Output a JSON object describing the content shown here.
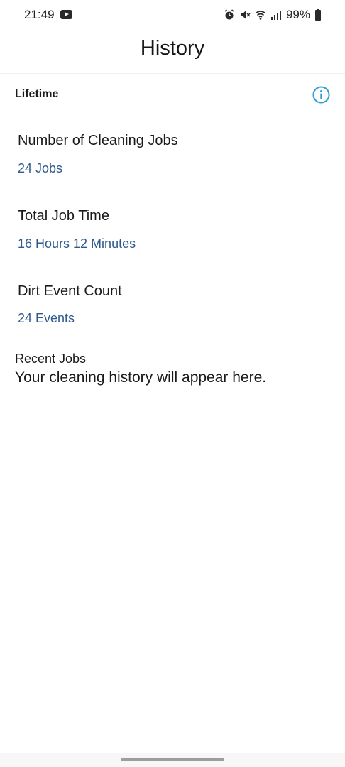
{
  "status_bar": {
    "time": "21:49",
    "battery": "99%",
    "icons": [
      "youtube-icon",
      "alarm-icon",
      "mute-icon",
      "wifi-icon",
      "signal-icon",
      "battery-icon"
    ]
  },
  "header": {
    "title": "History"
  },
  "lifetime": {
    "label": "Lifetime",
    "info_icon": "info-icon",
    "stats": [
      {
        "title": "Number of Cleaning Jobs",
        "value": "24 Jobs"
      },
      {
        "title": "Total Job Time",
        "value": "16 Hours 12 Minutes"
      },
      {
        "title": "Dirt Event Count",
        "value": "24 Events"
      }
    ]
  },
  "recent": {
    "label": "Recent Jobs",
    "empty_message": "Your cleaning history will appear here."
  },
  "colors": {
    "accent": "#2f5a8e",
    "info_icon": "#2d9fd2",
    "text": "#1a1a1a"
  }
}
